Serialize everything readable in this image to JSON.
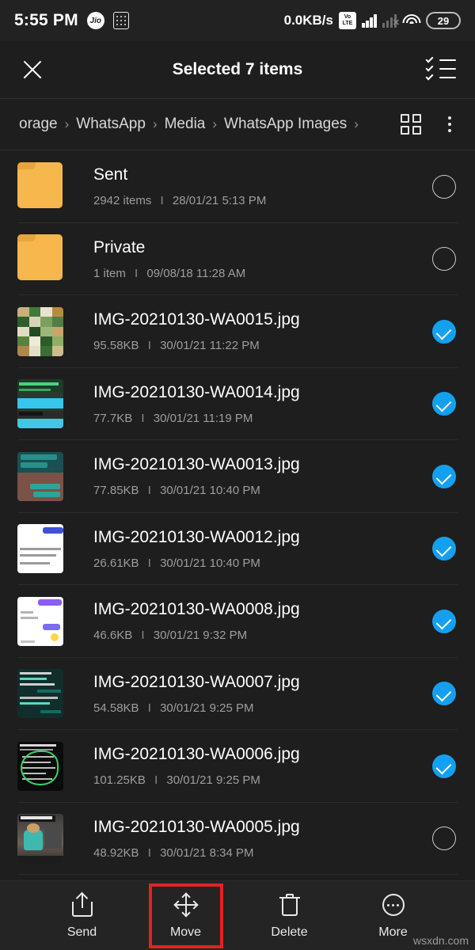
{
  "status_bar": {
    "time": "5:55 PM",
    "carrier_badge": "Jio",
    "grid_icon": "grid-dots-icon",
    "network_speed": "0.0KB/s",
    "volte_top": "Vo",
    "volte_bottom": "LTE",
    "battery_percent": "29"
  },
  "app_bar": {
    "close_label": "✕",
    "title": "Selected 7 items",
    "select_all_icon": "checklist-icon"
  },
  "breadcrumb": {
    "items": [
      "orage",
      "WhatsApp",
      "Media",
      "WhatsApp Images"
    ],
    "separator": "›",
    "trailing_separator": "›",
    "grid_view_icon": "grid-view-icon",
    "overflow_icon": "kebab-menu-icon"
  },
  "list": {
    "meta_separator": "I",
    "rows": [
      {
        "name": "Sent",
        "type": "folder",
        "size": "2942 items",
        "date": "28/01/21 5:13 PM",
        "selected": false
      },
      {
        "name": "Private",
        "type": "folder",
        "size": "1 item",
        "date": "09/08/18 11:28 AM",
        "selected": false
      },
      {
        "name": "IMG-20210130-WA0015.jpg",
        "type": "image",
        "size": "95.58KB",
        "date": "30/01/21 11:22 PM",
        "selected": true
      },
      {
        "name": "IMG-20210130-WA0014.jpg",
        "type": "image",
        "size": "77.7KB",
        "date": "30/01/21 11:19 PM",
        "selected": true
      },
      {
        "name": "IMG-20210130-WA0013.jpg",
        "type": "image",
        "size": "77.85KB",
        "date": "30/01/21 10:40 PM",
        "selected": true
      },
      {
        "name": "IMG-20210130-WA0012.jpg",
        "type": "image",
        "size": "26.61KB",
        "date": "30/01/21 10:40 PM",
        "selected": true
      },
      {
        "name": "IMG-20210130-WA0008.jpg",
        "type": "image",
        "size": "46.6KB",
        "date": "30/01/21 9:32 PM",
        "selected": true
      },
      {
        "name": "IMG-20210130-WA0007.jpg",
        "type": "image",
        "size": "54.58KB",
        "date": "30/01/21 9:25 PM",
        "selected": true
      },
      {
        "name": "IMG-20210130-WA0006.jpg",
        "type": "image",
        "size": "101.25KB",
        "date": "30/01/21 9:25 PM",
        "selected": true
      },
      {
        "name": "IMG-20210130-WA0005.jpg",
        "type": "image",
        "size": "48.92KB",
        "date": "30/01/21 8:34 PM",
        "selected": false
      }
    ]
  },
  "bottom_bar": {
    "actions": [
      {
        "label": "Send",
        "icon": "share-icon",
        "highlighted": false
      },
      {
        "label": "Move",
        "icon": "move-arrows-icon",
        "highlighted": true
      },
      {
        "label": "Delete",
        "icon": "trash-icon",
        "highlighted": false
      },
      {
        "label": "More",
        "icon": "more-circle-icon",
        "highlighted": false
      }
    ],
    "highlight_color": "#e42121"
  },
  "watermark": "wsxdn.com",
  "colors": {
    "background": "#1e1e1e",
    "status_bar_bg": "#222222",
    "bottom_bar_bg": "#242424",
    "checkbox_selected": "#14a0f0",
    "folder": "#f6b74c",
    "primary_text": "#ffffff",
    "secondary_text": "#9e9e9e"
  }
}
